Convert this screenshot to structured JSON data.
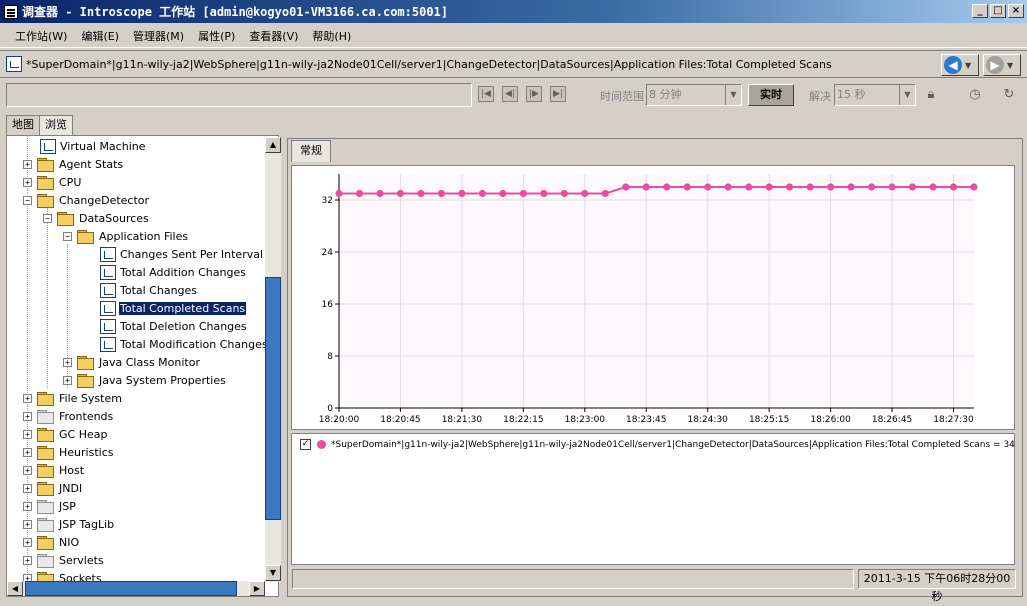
{
  "window": {
    "title": "调查器 - Introscope 工作站 [admin@kogyo01-VM3166.ca.com:5001]",
    "controls": [
      "_",
      "□",
      "×"
    ]
  },
  "menu": [
    {
      "label": "工作站(W)"
    },
    {
      "label": "编辑(E)"
    },
    {
      "label": "管理器(M)"
    },
    {
      "label": "属性(P)"
    },
    {
      "label": "查看器(V)"
    },
    {
      "label": "帮助(H)"
    }
  ],
  "path": {
    "text": "*SuperDomain*|g11n-wily-ja2|WebSphere|g11n-wily-ja2Node01Cell/server1|ChangeDetector|DataSources|Application Files:Total Completed Scans"
  },
  "toolbar": {
    "time_range_label": "时间范围",
    "time_range_value": "8 分钟",
    "live_label": "实时",
    "resolution_label": "解决",
    "resolution_value": "15 秒",
    "icons": [
      "first-icon",
      "prev-icon",
      "next-icon",
      "last-icon",
      "lock-icon",
      "timer-icon",
      "refresh-icon"
    ]
  },
  "left_tabs": [
    {
      "label": "地图"
    },
    {
      "label": "浏览"
    }
  ],
  "tree": [
    {
      "label": "Virtual Machine",
      "icon": "chart"
    },
    {
      "label": "Agent Stats",
      "icon": "folder"
    },
    {
      "label": "CPU",
      "icon": "folder"
    },
    {
      "label": "ChangeDetector",
      "icon": "folder"
    },
    {
      "label": "DataSources",
      "icon": "folder"
    },
    {
      "label": "Application Files",
      "icon": "folder"
    },
    {
      "label": "Changes Sent Per Interval",
      "icon": "chart"
    },
    {
      "label": "Total Addition Changes",
      "icon": "chart"
    },
    {
      "label": "Total Changes",
      "icon": "chart"
    },
    {
      "label": "Total Completed Scans",
      "icon": "chart",
      "selected": true
    },
    {
      "label": "Total Deletion Changes",
      "icon": "chart"
    },
    {
      "label": "Total Modification Changes",
      "icon": "chart"
    },
    {
      "label": "Java Class Monitor",
      "icon": "folder"
    },
    {
      "label": "Java System Properties",
      "icon": "folder"
    },
    {
      "label": "File System",
      "icon": "folder"
    },
    {
      "label": "Frontends",
      "icon": "folder-plain"
    },
    {
      "label": "GC Heap",
      "icon": "folder"
    },
    {
      "label": "Heuristics",
      "icon": "folder"
    },
    {
      "label": "Host",
      "icon": "folder"
    },
    {
      "label": "JNDI",
      "icon": "folder"
    },
    {
      "label": "JSP",
      "icon": "folder-plain"
    },
    {
      "label": "JSP TagLib",
      "icon": "folder-plain"
    },
    {
      "label": "NIO",
      "icon": "folder"
    },
    {
      "label": "Servlets",
      "icon": "folder-plain"
    },
    {
      "label": "Sockets",
      "icon": "folder"
    }
  ],
  "right_tab": {
    "label": "常规"
  },
  "chart_data": {
    "type": "line",
    "x_ticks": [
      "18:20:00",
      "18:20:45",
      "18:21:30",
      "18:22:15",
      "18:23:00",
      "18:23:45",
      "18:24:30",
      "18:25:15",
      "18:26:00",
      "18:26:45",
      "18:27:30"
    ],
    "y_ticks": [
      "0",
      "8",
      "16",
      "24",
      "32"
    ],
    "ylim": [
      0,
      36
    ],
    "grid": true,
    "series": [
      {
        "name": "*SuperDomain*|g11n-wily-ja2|WebSphere|g11n-wily-ja2Node01Cell/server1|ChangeDetector|DataSources|Application Files:Total Completed Scans = 34",
        "color": "#ea4ca0",
        "x_seconds": [
          0,
          15,
          30,
          45,
          60,
          75,
          90,
          105,
          120,
          135,
          150,
          165,
          180,
          195,
          210,
          225,
          240,
          255,
          270,
          285,
          300,
          315,
          330,
          345,
          360,
          375,
          390,
          405,
          420,
          435,
          450,
          465
        ],
        "values": [
          33,
          33,
          33,
          33,
          33,
          33,
          33,
          33,
          33,
          33,
          33,
          33,
          33,
          33,
          34,
          34,
          34,
          34,
          34,
          34,
          34,
          34,
          34,
          34,
          34,
          34,
          34,
          34,
          34,
          34,
          34,
          34
        ]
      }
    ]
  },
  "legend": {
    "checked": "✓"
  },
  "status": {
    "timestamp": "2011-3-15 下午06时28分00秒"
  }
}
